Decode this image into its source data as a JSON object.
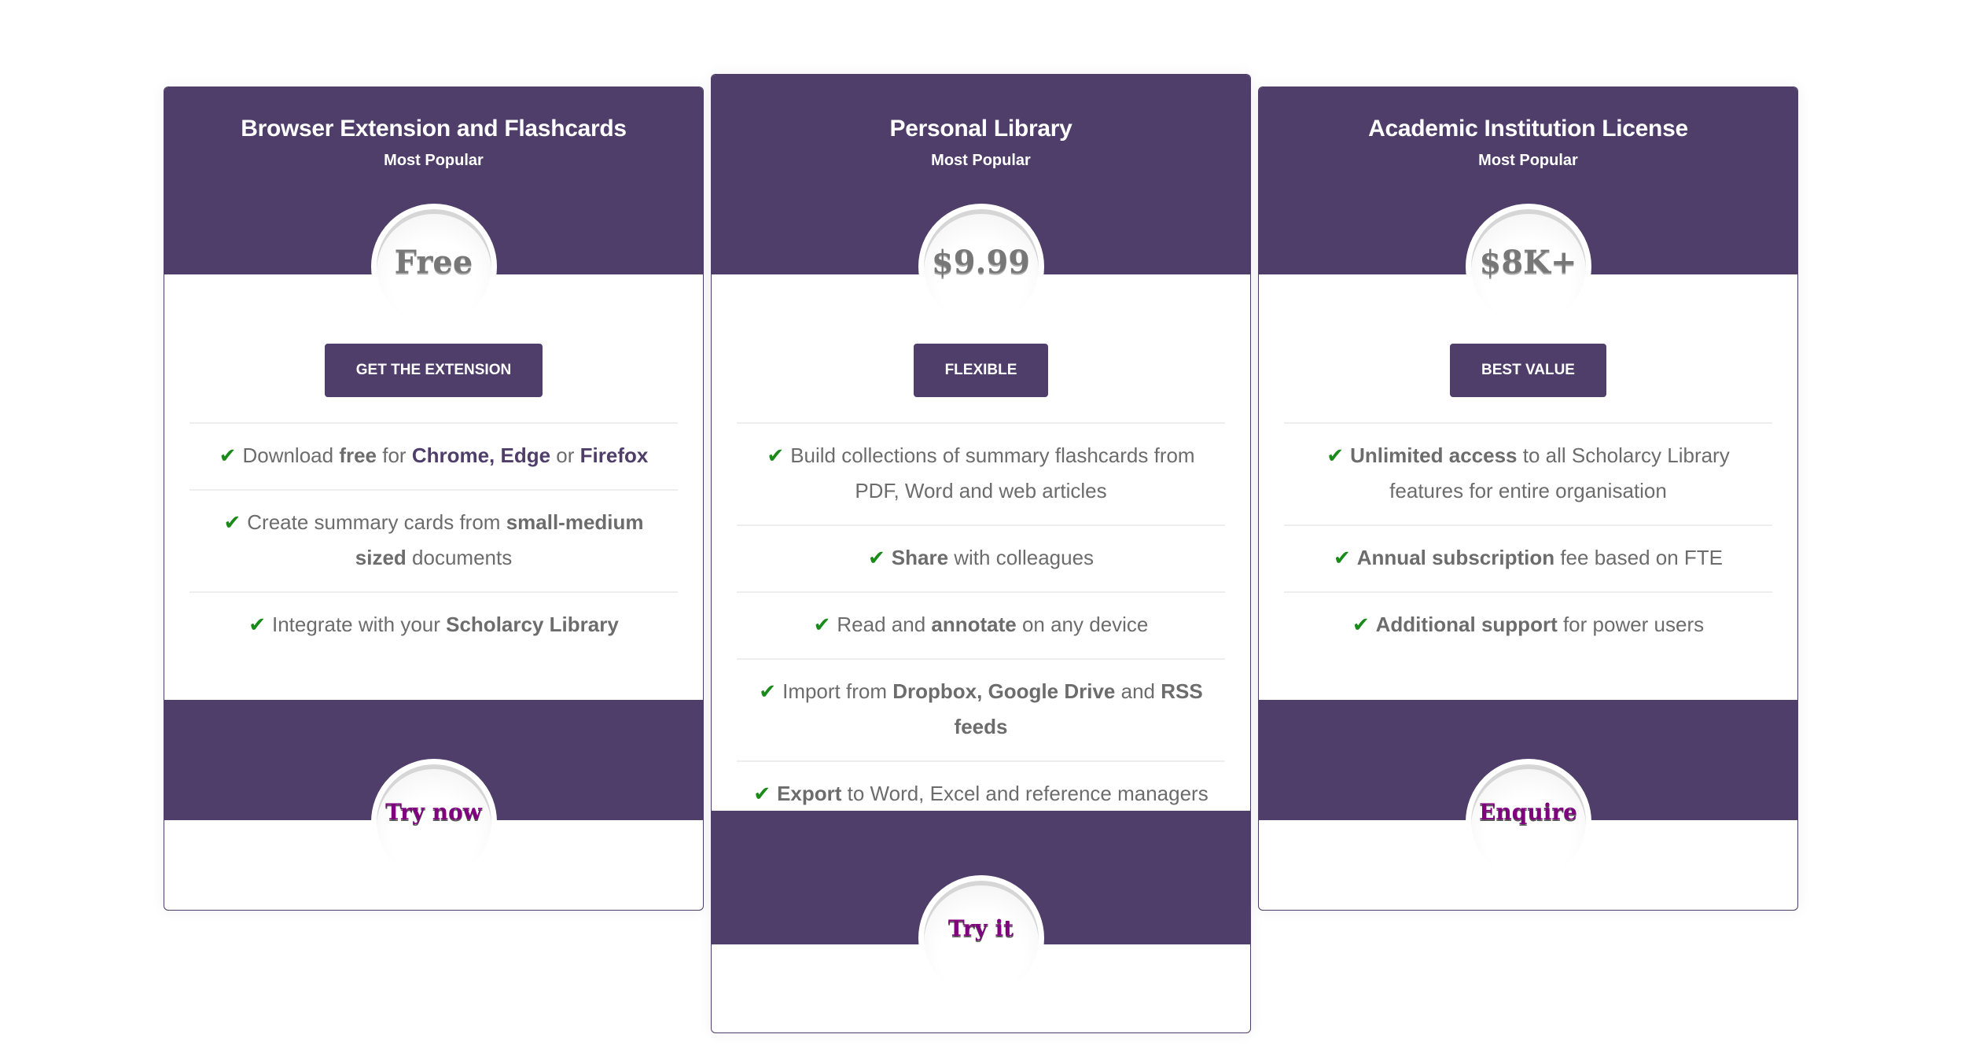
{
  "plans": [
    {
      "title": "Browser Extension and Flashcards",
      "subtitle": "Most Popular",
      "price": "Free",
      "button": "GET THE EXTENSION",
      "cta": "Try now",
      "features": [
        {
          "parts": [
            {
              "t": "Download "
            },
            {
              "t": "free",
              "b": 1
            },
            {
              "t": " for "
            },
            {
              "t": "Chrome, Edge",
              "b": 2
            },
            {
              "t": " or "
            },
            {
              "t": "Firefox",
              "b": 2
            }
          ]
        },
        {
          "parts": [
            {
              "t": "Create summary cards from "
            },
            {
              "t": "small-medium sized",
              "b": 1
            },
            {
              "t": " documents"
            }
          ]
        },
        {
          "parts": [
            {
              "t": "Integrate with your "
            },
            {
              "t": "Scholarcy Library",
              "b": 1
            }
          ]
        }
      ]
    },
    {
      "title": "Personal Library",
      "subtitle": "Most Popular",
      "price": "$9.99",
      "button": "FLEXIBLE",
      "cta": "Try it",
      "features": [
        {
          "parts": [
            {
              "t": "Build collections of summary flashcards from PDF, Word and web articles"
            }
          ]
        },
        {
          "parts": [
            {
              "t": "Share",
              "b": 1
            },
            {
              "t": " with colleagues"
            }
          ]
        },
        {
          "parts": [
            {
              "t": "Read and "
            },
            {
              "t": "annotate",
              "b": 1
            },
            {
              "t": " on any device"
            }
          ]
        },
        {
          "parts": [
            {
              "t": "Import from "
            },
            {
              "t": "Dropbox, Google Drive",
              "b": 1
            },
            {
              "t": " and "
            },
            {
              "t": "RSS feeds",
              "b": 1
            }
          ]
        },
        {
          "parts": [
            {
              "t": "Export",
              "b": 1
            },
            {
              "t": " to Word, Excel and reference managers"
            }
          ]
        }
      ]
    },
    {
      "title": "Academic Institution License",
      "subtitle": "Most Popular",
      "price": "$8K+",
      "button": "BEST VALUE",
      "cta": "Enquire",
      "features": [
        {
          "parts": [
            {
              "t": "Unlimited access",
              "b": 1
            },
            {
              "t": " to all Scholarcy Library features for entire organisation"
            }
          ]
        },
        {
          "parts": [
            {
              "t": "Annual subscription",
              "b": 1
            },
            {
              "t": " fee based on FTE"
            }
          ]
        },
        {
          "parts": [
            {
              "t": "Additional support",
              "b": 1
            },
            {
              "t": " for power users"
            }
          ]
        }
      ]
    }
  ],
  "icons": {
    "feature_check": "check-icon"
  }
}
